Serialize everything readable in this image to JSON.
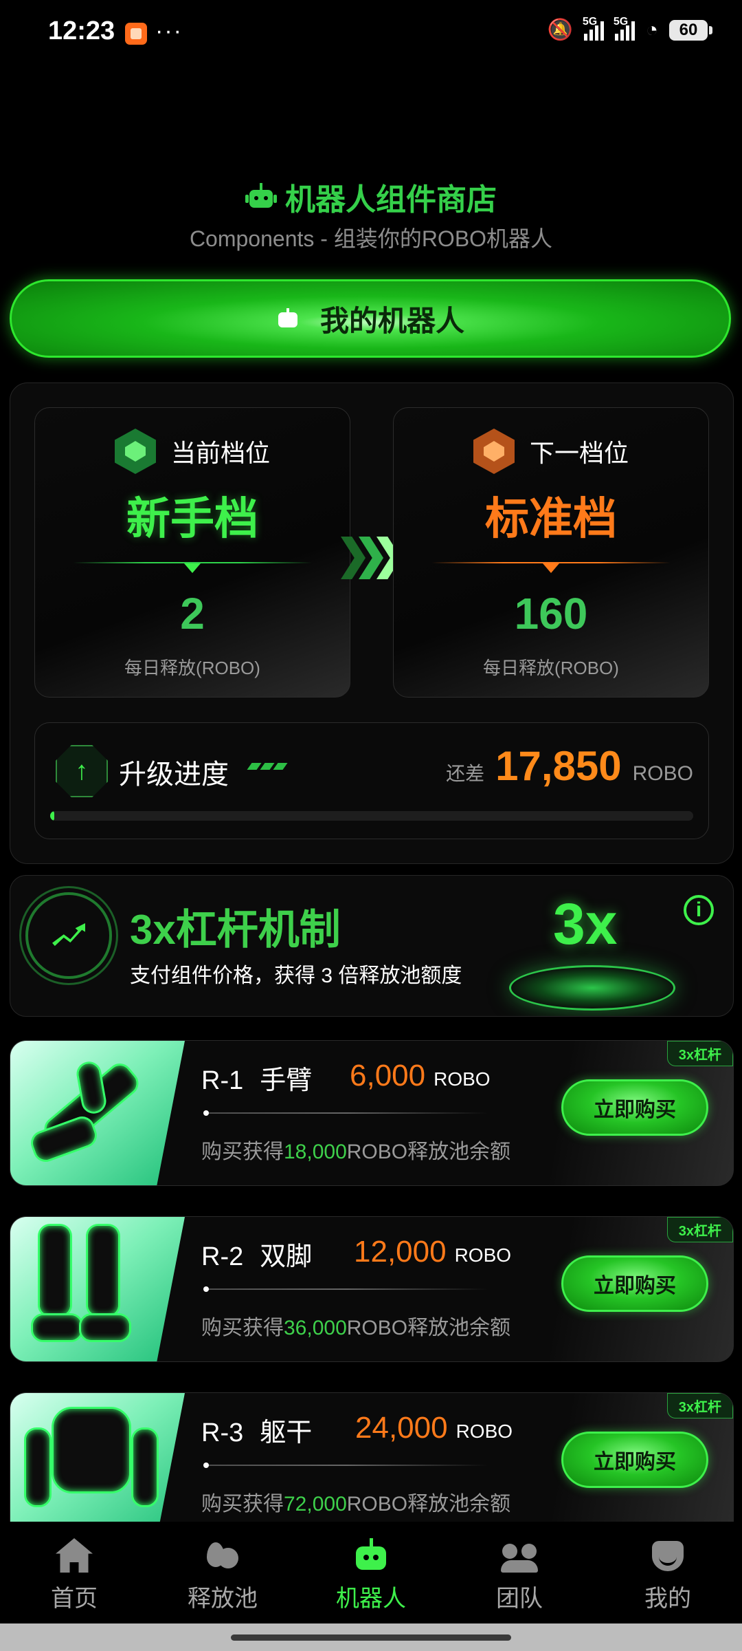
{
  "status_bar": {
    "time": "12:23",
    "dots": "···",
    "net1": "5G",
    "net2": "5G",
    "battery": "60"
  },
  "header": {
    "title": "机器人组件商店",
    "subtitle": "Components - 组装你的ROBO机器人",
    "my_robot_button": "我的机器人"
  },
  "tiers": {
    "current": {
      "label": "当前档位",
      "name": "新手档",
      "value": "2",
      "unit": "每日释放(ROBO)"
    },
    "next": {
      "label": "下一档位",
      "name": "标准档",
      "value": "160",
      "unit": "每日释放(ROBO)"
    }
  },
  "progress": {
    "label": "升级进度",
    "remaining_prefix": "还差",
    "remaining_amount": "17,850",
    "remaining_unit": "ROBO",
    "fill_fraction": 0.005
  },
  "leverage": {
    "title": "3x杠杆机制",
    "description": "支付组件价格，获得 3 倍释放池额度",
    "badge": "3x",
    "info_icon": "info-icon"
  },
  "products": [
    {
      "code": "R-1",
      "name": "手臂",
      "price": "6,000",
      "currency": "ROBO",
      "desc_prefix": "购买获得",
      "desc_amount": "18,000",
      "desc_suffix": "ROBO释放池余额",
      "button": "立即购买",
      "tag": "3x杠杆"
    },
    {
      "code": "R-2",
      "name": "双脚",
      "price": "12,000",
      "currency": "ROBO",
      "desc_prefix": "购买获得",
      "desc_amount": "36,000",
      "desc_suffix": "ROBO释放池余额",
      "button": "立即购买",
      "tag": "3x杠杆"
    },
    {
      "code": "R-3",
      "name": "躯干",
      "price": "24,000",
      "currency": "ROBO",
      "desc_prefix": "购买获得",
      "desc_amount": "72,000",
      "desc_suffix": "ROBO释放池余额",
      "button": "立即购买",
      "tag": "3x杠杆"
    }
  ],
  "nav": [
    {
      "label": "首页",
      "icon": "home-icon"
    },
    {
      "label": "释放池",
      "icon": "pool-icon"
    },
    {
      "label": "机器人",
      "icon": "robot-icon",
      "active": true
    },
    {
      "label": "团队",
      "icon": "team-icon"
    },
    {
      "label": "我的",
      "icon": "profile-icon"
    }
  ],
  "colors": {
    "accent_green": "#3ef04b",
    "accent_orange": "#ff7a1a",
    "background": "#000000"
  }
}
